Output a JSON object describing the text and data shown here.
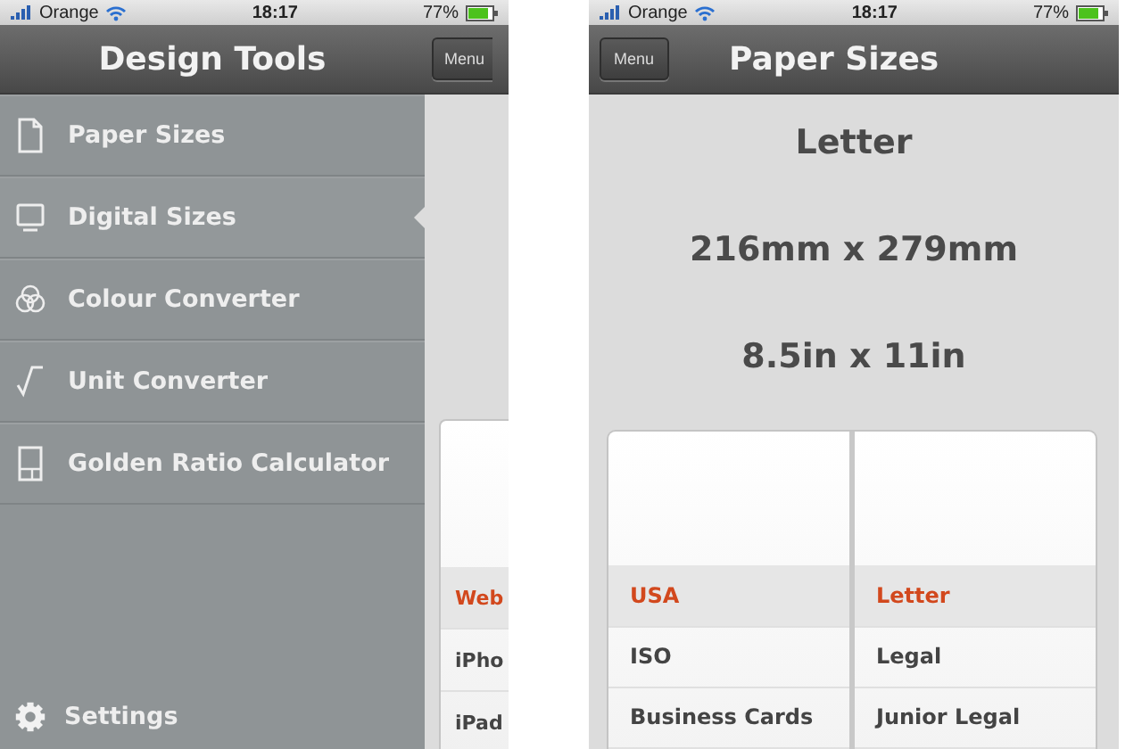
{
  "menu_screen": {
    "status_bar": {
      "carrier": "Orange",
      "time": "18:17",
      "battery": "77%"
    },
    "title": "Design Tools",
    "items": [
      {
        "label": "Paper Sizes",
        "kind": "page",
        "selected": false
      },
      {
        "label": "Digital Sizes",
        "kind": "screen",
        "selected": true
      },
      {
        "label": "Colour Converter",
        "kind": "circles",
        "selected": false
      },
      {
        "label": "Unit Converter",
        "kind": "root",
        "selected": false
      },
      {
        "label": "Golden Ratio Calculator",
        "kind": "ratio",
        "selected": false
      }
    ],
    "settings": "Settings",
    "peek": {
      "menu_button": "Menu",
      "picker_items": [
        {
          "label": "Web",
          "selected": true
        },
        {
          "label": "iPho",
          "selected": false
        },
        {
          "label": "iPad",
          "selected": false
        }
      ]
    }
  },
  "paper_screen": {
    "status_bar": {
      "carrier": "Orange",
      "time": "18:17",
      "battery": "77%"
    },
    "menu_button": "Menu",
    "title": "Paper Sizes",
    "size_name": "Letter",
    "metric": "216mm x 279mm",
    "imperial": "8.5in x 11in",
    "picker_columns": [
      {
        "items": [
          {
            "label": "USA",
            "selected": true
          },
          {
            "label": "ISO",
            "selected": false
          },
          {
            "label": "Business Cards",
            "selected": false
          }
        ]
      },
      {
        "items": [
          {
            "label": "Letter",
            "selected": true
          },
          {
            "label": "Legal",
            "selected": false
          },
          {
            "label": "Junior Legal",
            "selected": false
          }
        ]
      }
    ]
  }
}
